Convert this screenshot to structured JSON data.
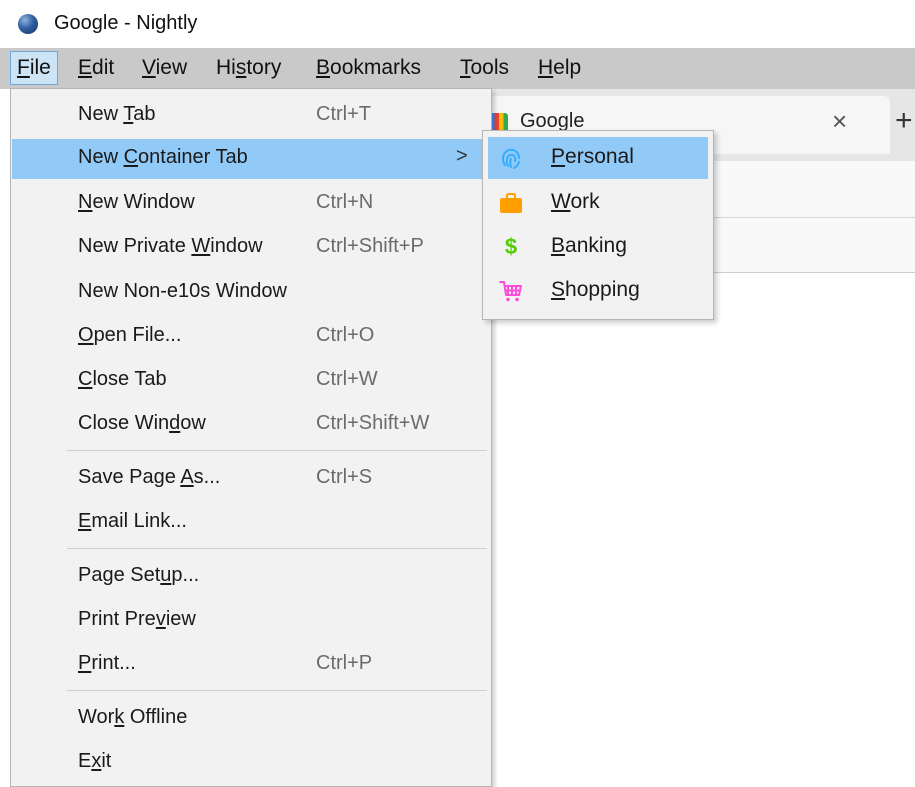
{
  "window": {
    "title": "Google - Nightly"
  },
  "menubar": [
    {
      "label": "File",
      "accel": "F",
      "rest": "ile",
      "open": true
    },
    {
      "label": "Edit",
      "accel": "E",
      "rest": "dit"
    },
    {
      "label": "View",
      "accel": "V",
      "rest": "iew"
    },
    {
      "label": "History",
      "pre": "Hi",
      "accel": "s",
      "post": "tory"
    },
    {
      "label": "Bookmarks",
      "accel": "B",
      "rest": "ookmarks"
    },
    {
      "label": "Tools",
      "accel": "T",
      "rest": "ools"
    },
    {
      "label": "Help",
      "accel": "H",
      "rest": "elp"
    }
  ],
  "tab": {
    "title": "Google",
    "close": "×",
    "new_tab": "+"
  },
  "file_menu": {
    "new_tab": {
      "pre": "New ",
      "accel": "T",
      "post": "ab",
      "shortcut": "Ctrl+T"
    },
    "new_container_tab": {
      "pre": "New ",
      "accel": "C",
      "post": "ontainer Tab",
      "arrow": ">"
    },
    "new_window": {
      "pre": "",
      "accel": "N",
      "post": "ew Window",
      "shortcut": "Ctrl+N"
    },
    "new_private_window": {
      "pre": "New Private ",
      "accel": "W",
      "post": "indow",
      "shortcut": "Ctrl+Shift+P"
    },
    "new_non_e10s_window": {
      "label": "New Non-e10s Window"
    },
    "open_file": {
      "pre": "",
      "accel": "O",
      "post": "pen File...",
      "shortcut": "Ctrl+O"
    },
    "close_tab": {
      "pre": "",
      "accel": "C",
      "post": "lose Tab",
      "shortcut": "Ctrl+W"
    },
    "close_window": {
      "pre": "Close Win",
      "accel": "d",
      "post": "ow",
      "shortcut": "Ctrl+Shift+W"
    },
    "save_page_as": {
      "pre": "Save Page ",
      "accel": "A",
      "post": "s...",
      "shortcut": "Ctrl+S"
    },
    "email_link": {
      "pre": "",
      "accel": "E",
      "post": "mail Link..."
    },
    "page_setup": {
      "pre": "Page Set",
      "accel": "u",
      "post": "p..."
    },
    "print_preview": {
      "pre": "Print Pre",
      "accel": "v",
      "post": "iew"
    },
    "print": {
      "pre": "",
      "accel": "P",
      "post": "rint...",
      "shortcut": "Ctrl+P"
    },
    "work_offline": {
      "pre": "Wor",
      "accel": "k",
      "post": " Offline"
    },
    "exit": {
      "pre": "E",
      "accel": "x",
      "post": "it"
    }
  },
  "container_menu": {
    "personal": {
      "accel": "P",
      "post": "ersonal",
      "icon": "fingerprint-icon",
      "color": "#37adff"
    },
    "work": {
      "accel": "W",
      "post": "ork",
      "icon": "briefcase-icon",
      "color": "#ff9f00"
    },
    "banking": {
      "accel": "B",
      "post": "anking",
      "icon": "dollar-icon",
      "glyph": "$",
      "color": "#51cd00"
    },
    "shopping": {
      "accel": "S",
      "post": "hopping",
      "icon": "cart-icon",
      "color": "#ff4bda"
    }
  }
}
